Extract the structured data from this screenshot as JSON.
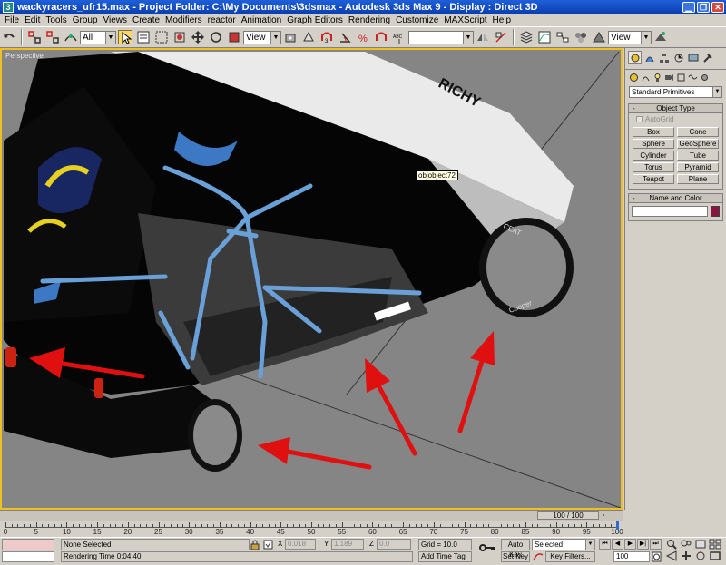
{
  "window": {
    "title": "wackyracers_ufr15.max     - Project Folder: C:\\My Documents\\3dsmax     - Autodesk 3ds Max 9     - Display : Direct 3D",
    "icon_text": "3"
  },
  "menu": [
    "File",
    "Edit",
    "Tools",
    "Group",
    "Views",
    "Create",
    "Modifiers",
    "reactor",
    "Animation",
    "Graph Editors",
    "Rendering",
    "Customize",
    "MAXScript",
    "Help"
  ],
  "toolbar": {
    "selection_filter": "All",
    "ref_coord": "View",
    "named_selection": "",
    "render_view": "View"
  },
  "viewport": {
    "label": "Perspective",
    "tooltip": "objobject72",
    "car_text": "RICHY",
    "tire_text_1": "CEAT",
    "tire_text_2": "Cooper"
  },
  "command_panel": {
    "primitive_type": "Standard Primitives",
    "object_type_title": "Object Type",
    "autogrid_label": "AutoGrid",
    "buttons": [
      "Box",
      "Cone",
      "Sphere",
      "GeoSphere",
      "Cylinder",
      "Tube",
      "Torus",
      "Pyramid",
      "Teapot",
      "Plane"
    ],
    "name_color_title": "Name and Color",
    "name_value": "",
    "object_color": "#8c1440"
  },
  "timeline": {
    "frame_display": "100 / 100",
    "current_frame": 100,
    "total_frames": 100,
    "tick_labels": [
      "0",
      "5",
      "10",
      "15",
      "20",
      "25",
      "30",
      "35",
      "40",
      "45",
      "50",
      "55",
      "60",
      "65",
      "70",
      "75",
      "80",
      "85",
      "90",
      "95",
      "100"
    ]
  },
  "status": {
    "selection_text": "None Selected",
    "render_time": "Rendering Time  0:04:40",
    "x_label": "X",
    "x_value": "0.018",
    "y_label": "Y",
    "y_value": "1.189",
    "z_label": "Z",
    "z_value": "0.0",
    "grid": "Grid = 10.0",
    "add_time_tag": "Add Time Tag",
    "auto_key": "Auto Key",
    "set_key": "Set Key",
    "key_mode": "Selected",
    "key_filters": "Key Filters...",
    "frame_field": "100"
  },
  "colors": {
    "viewport_border": "#f0c020",
    "title_bar": "#0a3fb0",
    "arrow_red": "#e01010"
  }
}
